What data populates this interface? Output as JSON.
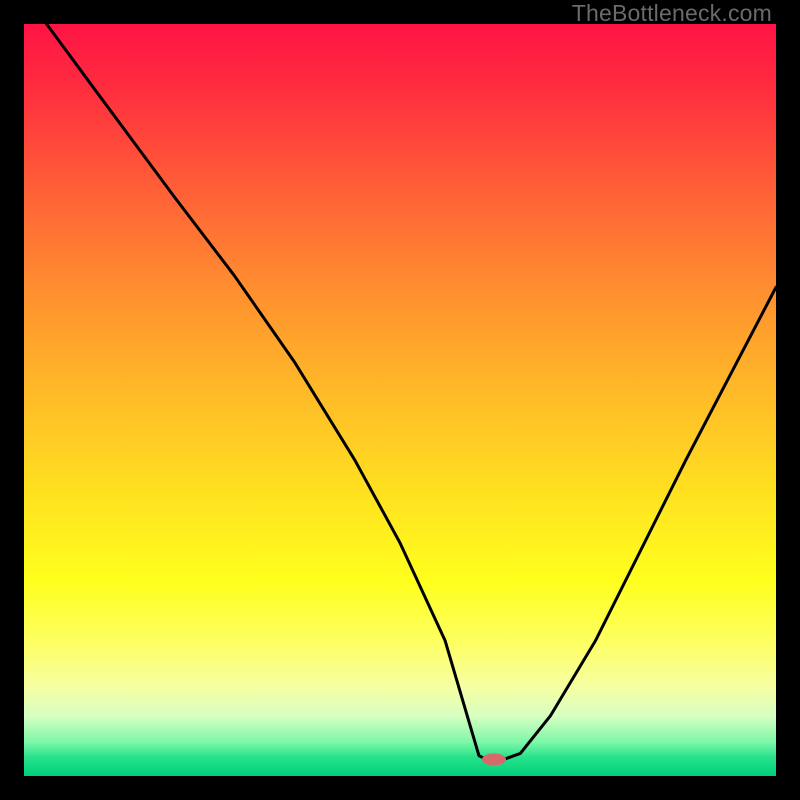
{
  "watermark": "TheBottleneck.com",
  "chart_data": {
    "type": "line",
    "title": "",
    "xlabel": "",
    "ylabel": "",
    "xlim": [
      0,
      100
    ],
    "ylim": [
      0,
      100
    ],
    "grid": false,
    "series": [
      {
        "name": "curve",
        "x": [
          3,
          10,
          20,
          28,
          36,
          44,
          50,
          56,
          58.5,
          60.5,
          61.5,
          63.5,
          66,
          70,
          76,
          82,
          88,
          94,
          100
        ],
        "y": [
          100,
          90.5,
          77,
          66.5,
          55,
          42,
          31,
          18,
          9.5,
          2.7,
          2.2,
          2.1,
          3.0,
          8,
          18,
          30,
          42,
          53.5,
          65
        ]
      }
    ],
    "marker": {
      "x": 62.5,
      "y": 2.2,
      "color": "#d46a6a",
      "rx": 12,
      "ry": 6
    }
  }
}
